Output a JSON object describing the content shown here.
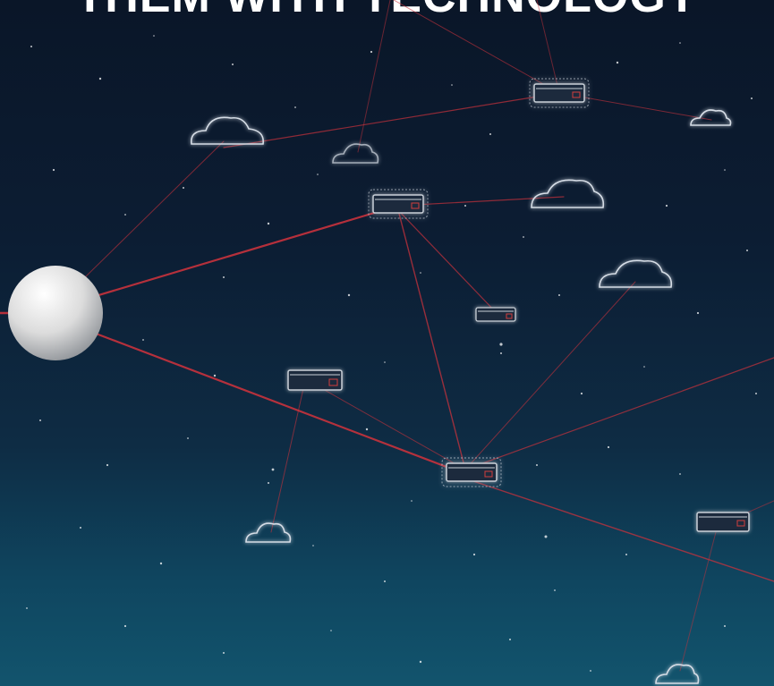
{
  "headline": "THEM WITH TECHNOLOGY",
  "colors": {
    "link": "#c8323c",
    "device_outline": "#c9d0d8",
    "device_led": "#d23c3c",
    "cloud": "#d6dde6",
    "sphere": "#e8e8e8"
  },
  "icons": {
    "hub": "sphere-node",
    "server": "server-icon",
    "cloud": "cloud-icon"
  }
}
